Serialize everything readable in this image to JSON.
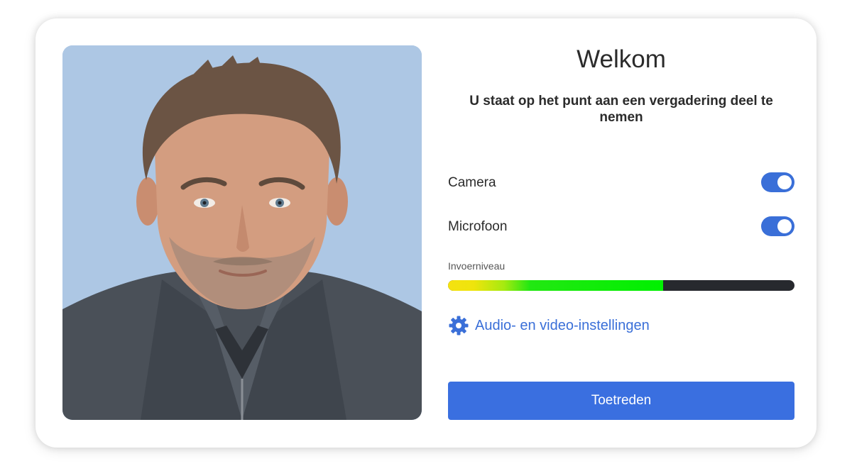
{
  "prejoin": {
    "title": "Welkom",
    "subtitle": "U staat op het punt aan een vergadering deel te nemen",
    "camera": {
      "label": "Camera",
      "enabled": true
    },
    "microphone": {
      "label": "Microfoon",
      "enabled": true
    },
    "input_level": {
      "label": "Invoerniveau",
      "level_percent": 62
    },
    "settings_link": {
      "label": "Audio- en video-instellingen",
      "icon": "gear-icon"
    },
    "join_button": {
      "label": "Toetreden"
    },
    "preview": {
      "description_icon": "camera-preview"
    }
  },
  "colors": {
    "accent": "#3a6fe0",
    "link": "#3a6fd8",
    "preview_background": "#adc7e4",
    "level_track": "#27292e"
  }
}
